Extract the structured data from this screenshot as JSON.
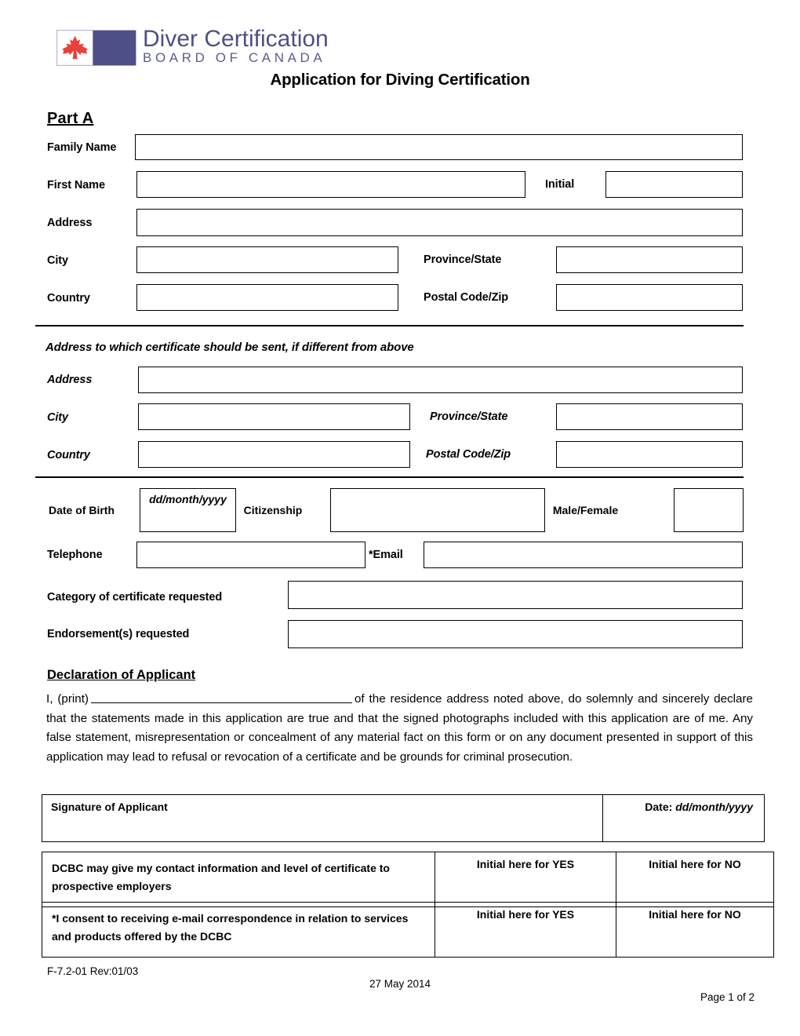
{
  "logo": {
    "line1": "Diver Certification",
    "line2": "BOARD OF CANADA",
    "flag_icon": "canada-flag-pennant-icon",
    "purple": "#4f4f87",
    "red": "#e8403a"
  },
  "title": "Application for Diving Certification",
  "part_a": {
    "heading": "Part A",
    "family_name_label": "Family Name",
    "first_name_label": "First Name",
    "initial_label": "Initial",
    "address_label": "Address",
    "city_label": "City",
    "province_label": "Province/State",
    "country_label": "Country",
    "postal_label": "Postal Code/Zip",
    "family_name_value": "",
    "first_name_value": "",
    "initial_value": "",
    "address_value": "",
    "city_value": "",
    "province_value": "",
    "country_value": "",
    "postal_value": ""
  },
  "alt_address": {
    "note": "Address to which certificate should be sent, if different from above",
    "address_label": "Address",
    "city_label": "City",
    "province_label": "Province/State",
    "country_label": "Country",
    "postal_label": "Postal Code/Zip",
    "address_value": "",
    "city_value": "",
    "province_value": "",
    "country_value": "",
    "postal_value": ""
  },
  "personal": {
    "dob_label": "Date of Birth",
    "dob_format": "dd/month/yyyy",
    "citizenship_label": "Citizenship",
    "citizenship_value": "",
    "gender_label": "Male/Female",
    "gender_value": "",
    "telephone_label": "Telephone",
    "telephone_value": "",
    "email_label": "*Email",
    "email_value": "",
    "category_label": "Category of certificate requested",
    "category_value": "",
    "endorsement_label": "Endorsement(s) requested",
    "endorsement_value": ""
  },
  "declaration": {
    "heading": "Declaration of Applicant",
    "lead_in": "I, (print)",
    "body": "of the residence address noted above, do solemnly and sincerely declare that the statements made in this application are true and that the signed photographs included with this application are of me.  Any false statement, misrepresentation or concealment of any material fact on this form or on any document presented in support of this application may lead to refusal or revocation of a certificate and be grounds for criminal prosecution."
  },
  "signature_table": {
    "signature_label": "Signature of Applicant",
    "date_label": "Date",
    "date_format": "dd/month/yyyy",
    "signature_value": "",
    "date_value": ""
  },
  "consent_rows": [
    {
      "text": "DCBC may give my contact information and level of certificate to prospective employers",
      "yes_label": "Initial here for YES",
      "no_label": "Initial here for NO",
      "yes_value": "",
      "no_value": ""
    },
    {
      "text": "*I consent to receiving e-mail correspondence in relation to services and products offered by the DCBC",
      "yes_label": "Initial here for YES",
      "no_label": "Initial here for NO",
      "yes_value": "",
      "no_value": ""
    }
  ],
  "footer": {
    "form_code": "F-7.2-01 Rev:01/03",
    "date": "27 May 2014",
    "page": "Page 1 of 2"
  }
}
